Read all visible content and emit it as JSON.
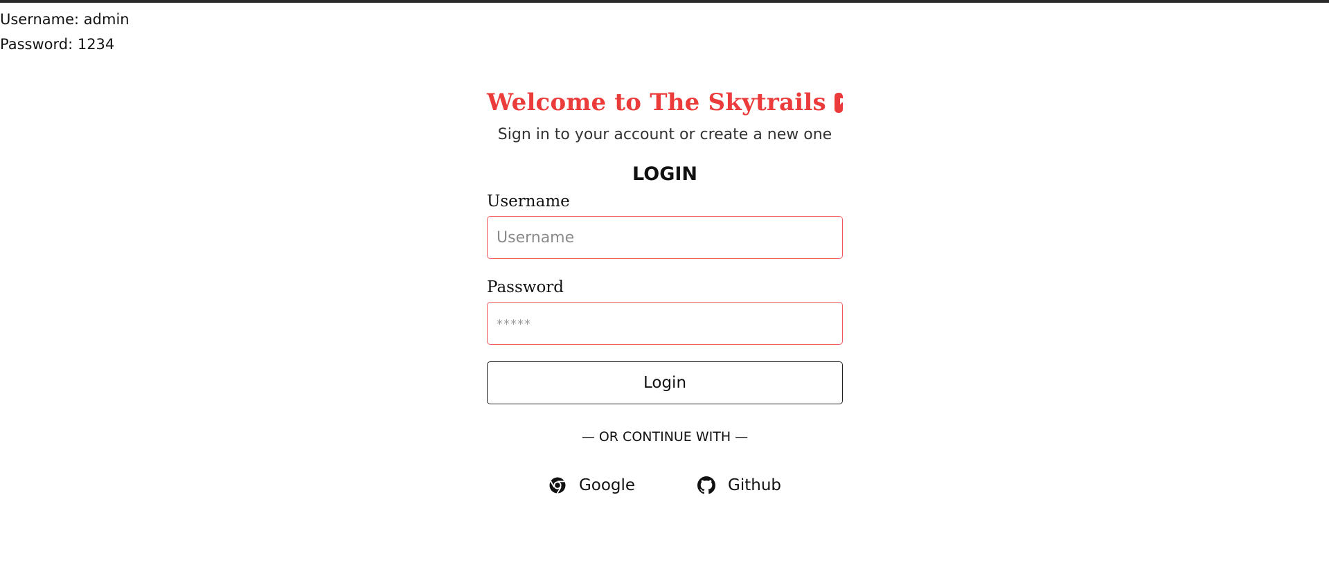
{
  "credentials": {
    "username_hint": "Username: admin",
    "password_hint": "Password: 1234"
  },
  "header": {
    "title": "Welcome to The Skytrails",
    "subtitle": "Sign in to your account or create a new one",
    "logo_icon": "arrow-square-icon"
  },
  "form": {
    "heading": "LOGIN",
    "username_label": "Username",
    "username_placeholder": "Username",
    "username_value": "",
    "password_label": "Password",
    "password_placeholder": "*****",
    "password_value": "",
    "submit_label": "Login"
  },
  "social": {
    "divider": "— OR CONTINUE WITH —",
    "google_label": "Google",
    "google_icon": "chrome-icon",
    "github_label": "Github",
    "github_icon": "github-icon"
  },
  "colors": {
    "brand": "#ec3b3b",
    "input_border": "#f25a5a"
  }
}
